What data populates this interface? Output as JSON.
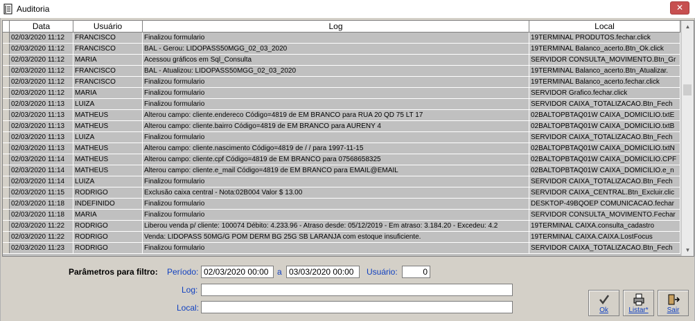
{
  "window": {
    "title": "Auditoria",
    "close_glyph": "✕"
  },
  "grid": {
    "columns": [
      "Data",
      "Usuário",
      "Log",
      "Local"
    ],
    "rows": [
      [
        "02/03/2020 11:12",
        "FRANCISCO",
        "Finalizou formulario",
        "19TERMINAL PRODUTOS.fechar.click"
      ],
      [
        "02/03/2020 11:12",
        "FRANCISCO",
        "BAL - Gerou: LIDOPASS50MGG_02_03_2020",
        "19TERMINAL Balanco_acerto.Btn_Ok.click"
      ],
      [
        "02/03/2020 11:12",
        "MARIA",
        "Acessou gráficos em Sql_Consulta",
        "SERVIDOR CONSULTA_MOVIMENTO.Btn_Gr"
      ],
      [
        "02/03/2020 11:12",
        "FRANCISCO",
        "BAL - Atualizou: LIDOPASS50MGG_02_03_2020",
        "19TERMINAL Balanco_acerto.Btn_Atualizar."
      ],
      [
        "02/03/2020 11:12",
        "FRANCISCO",
        "Finalizou formulario",
        "19TERMINAL Balanco_acerto.fechar.click"
      ],
      [
        "02/03/2020 11:12",
        "MARIA",
        "Finalizou formulario",
        "SERVIDOR Grafico.fechar.click"
      ],
      [
        "02/03/2020 11:13",
        "LUIZA",
        "Finalizou formulario",
        "SERVIDOR CAIXA_TOTALIZACAO.Btn_Fech"
      ],
      [
        "02/03/2020 11:13",
        "MATHEUS",
        "Alterou campo: cliente.endereco Código=4819 de  EM BRANCO para RUA 20 QD 75 LT 17",
        "02BALTOPBTAQ01W CAIXA_DOMICILIO.txtE"
      ],
      [
        "02/03/2020 11:13",
        "MATHEUS",
        "Alterou campo: cliente.bairro Código=4819 de  EM BRANCO para AURENY 4",
        "02BALTOPBTAQ01W CAIXA_DOMICILIO.txtB"
      ],
      [
        "02/03/2020 11:13",
        "LUIZA",
        "Finalizou formulario",
        "SERVIDOR CAIXA_TOTALIZACAO.Btn_Fech"
      ],
      [
        "02/03/2020 11:13",
        "MATHEUS",
        "Alterou campo: cliente.nascimento Código=4819 de /  / para 1997-11-15",
        "02BALTOPBTAQ01W CAIXA_DOMICILIO.txtN"
      ],
      [
        "02/03/2020 11:14",
        "MATHEUS",
        "Alterou campo: cliente.cpf Código=4819 de  EM BRANCO para 07568658325",
        "02BALTOPBTAQ01W CAIXA_DOMICILIO.CPF"
      ],
      [
        "02/03/2020 11:14",
        "MATHEUS",
        "Alterou campo: cliente.e_mail Código=4819 de  EM BRANCO para EMAIL@EMAIL",
        "02BALTOPBTAQ01W CAIXA_DOMICILIO.e_n"
      ],
      [
        "02/03/2020 11:14",
        "LUIZA",
        "Finalizou formulario",
        "SERVIDOR CAIXA_TOTALIZACAO.Btn_Fech"
      ],
      [
        "02/03/2020 11:15",
        "RODRIGO",
        "Exclusão caixa central - Nota:02B004 Valor $      13.00",
        "SERVIDOR CAIXA_CENTRAL.Btn_Excluir.clic"
      ],
      [
        "02/03/2020 11:18",
        "INDEFINIDO",
        "Finalizou formulario",
        "DESKTOP-49BQOEP COMUNICACAO.fechar"
      ],
      [
        "02/03/2020 11:18",
        "MARIA",
        "Finalizou formulario",
        "SERVIDOR CONSULTA_MOVIMENTO.Fechar"
      ],
      [
        "02/03/2020 11:22",
        "RODRIGO",
        "Liberou venda p/ cliente: 100074 Débito:    4.233.96 - Atraso desde: 05/12/2019 - Em atraso:  3.184.20 - Excedeu:  4.2",
        "19TERMINAL CAIXA.consulta_cadastro"
      ],
      [
        "02/03/2020 11:22",
        "RODRIGO",
        "Venda: LIDOPASS 50MG/G POM DERM BG 25G SB LARANJA com estoque insuficiente.",
        "19TERMINAL CAIXA.CAIXA.LostFocus"
      ],
      [
        "02/03/2020 11:23",
        "RODRIGO",
        "Finalizou formulario",
        "SERVIDOR CAIXA_TOTALIZACAO.Btn_Fech"
      ]
    ]
  },
  "filter": {
    "title": "Parâmetros para filtro:",
    "period_label": "Período:",
    "date_from": "02/03/2020 00:00",
    "separator": "a",
    "date_to": "03/03/2020 00:00",
    "user_label": "Usuário:",
    "user_value": "0",
    "log_label": "Log:",
    "log_value": "",
    "local_label": "Local:",
    "local_value": ""
  },
  "buttons": {
    "ok": "Ok",
    "list": "Listar*",
    "exit": "Sair"
  },
  "icons": {
    "app": "notebook-app-icon",
    "ok": "checkmark-icon",
    "list": "printer-icon",
    "exit": "exit-door-icon"
  }
}
